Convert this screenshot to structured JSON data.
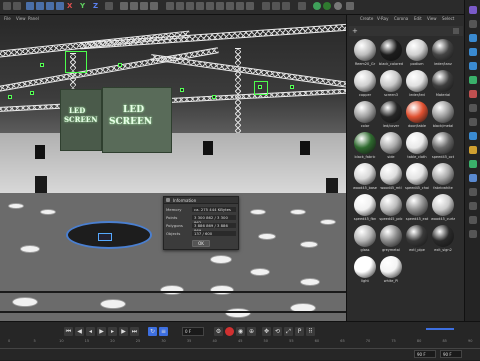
{
  "toolbar": {
    "axis_x": "X",
    "axis_y": "Y",
    "axis_z": "Z"
  },
  "menubar": {
    "items": [
      "File",
      "View",
      "Panel"
    ]
  },
  "viewport": {
    "led_screen_left_line1": "LED",
    "led_screen_left_line2": "SCREEN",
    "led_screen_right_line1": "LED",
    "led_screen_right_line2": "SCREEN"
  },
  "info_window": {
    "title": "Information",
    "rows": [
      {
        "key": "Memory",
        "value": "ca. 275 444 KBytes"
      },
      {
        "key": "Points",
        "value": "3 300 862 / 3 300 862"
      },
      {
        "key": "Polygons",
        "value": "3 886 869 / 3 886 869"
      },
      {
        "key": "Objects",
        "value": "137 / 600"
      }
    ],
    "ok_label": "OK"
  },
  "material_panel": {
    "tabs": [
      "Create",
      "V-Ray",
      "Corona",
      "Edit",
      "View",
      "Select"
    ],
    "materials": [
      {
        "name": "Reem20_Gr",
        "color": "#bdbdbd"
      },
      {
        "name": "black_colored",
        "color": "#1c1c1c"
      },
      {
        "name": "podium",
        "color": "#d0d0d0"
      },
      {
        "name": "leder/tanz",
        "color": "#444444"
      },
      {
        "name": "copper",
        "color": "#cfcfcf"
      },
      {
        "name": "screen3",
        "color": "#c8c8c8"
      },
      {
        "name": "leder/led",
        "color": "#e0e0e0"
      },
      {
        "name": "Material",
        "color": "#3e3e3e"
      },
      {
        "name": "color",
        "color": "#a0a0a0"
      },
      {
        "name": "led/cover",
        "color": "#262626"
      },
      {
        "name": "door/table",
        "color": "#e05030"
      },
      {
        "name": "black/metal",
        "color": "#9a9a9a"
      },
      {
        "name": "black_fabric",
        "color": "#2f6a2f"
      },
      {
        "name": "side",
        "color": "#aaaaaa"
      },
      {
        "name": "table_cloth",
        "color": "#e8e8e8"
      },
      {
        "name": "speed45_oct",
        "color": "#6a6a6a"
      },
      {
        "name": "wood45_base",
        "color": "#d8d8d8"
      },
      {
        "name": "wood45_mtl",
        "color": "#dddddd"
      },
      {
        "name": "speed45_chair",
        "color": "#e2e2e2"
      },
      {
        "name": "fabricwhite",
        "color": "#a8a8a8"
      },
      {
        "name": "speed45_fbn",
        "color": "#f0f0f0"
      },
      {
        "name": "speed45_pdc",
        "color": "#bcbcbc"
      },
      {
        "name": "speed45_eat",
        "color": "#909090"
      },
      {
        "name": "wood45_curtain",
        "color": "#cbcbcb"
      },
      {
        "name": "glass",
        "color": "#b5b5b5"
      },
      {
        "name": "greymetal",
        "color": "#8a8a8a"
      },
      {
        "name": "extl_pipe",
        "color": "#3a3a3a"
      },
      {
        "name": "exit_sign2",
        "color": "#2a2a2a"
      },
      {
        "name": "light",
        "color": "#ffffff"
      },
      {
        "name": "white_Pl",
        "color": "#f4f4f4"
      }
    ]
  },
  "timeline": {
    "current_frame": "0 F",
    "end_frame": "90 F",
    "end_frame2": "90 F",
    "ruler": [
      "0",
      "5",
      "10",
      "15",
      "20",
      "25",
      "30",
      "35",
      "40",
      "45",
      "50",
      "55",
      "60",
      "65",
      "70",
      "75",
      "80",
      "85",
      "90"
    ]
  },
  "colors": {
    "accent_blue": "#3d6fe0",
    "selection_green": "#4cff4c",
    "record_red": "#d03030"
  }
}
